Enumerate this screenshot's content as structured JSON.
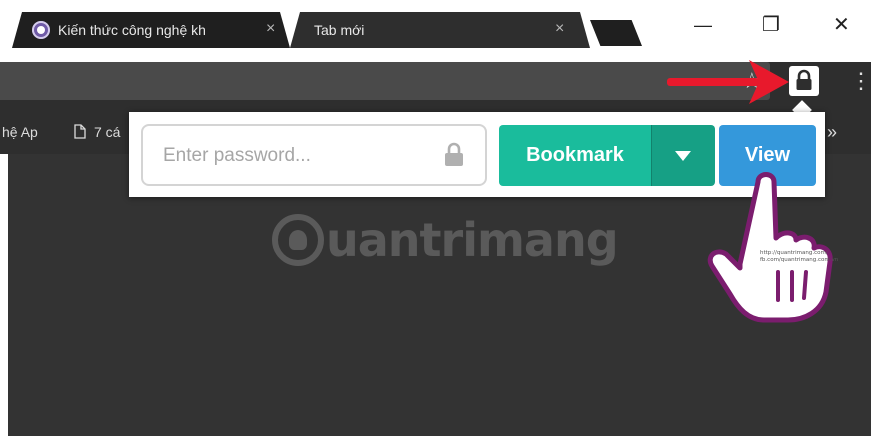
{
  "tabs": [
    {
      "title": "Kiến thức công nghệ kh",
      "active": false
    },
    {
      "title": "Tab mới",
      "active": true
    }
  ],
  "tab_close_glyph": "×",
  "window_controls": {
    "minimize": "—",
    "restore": "❐",
    "close": "✕"
  },
  "toolbar": {
    "star_glyph": "☆",
    "menu_glyph": "⋮"
  },
  "bookmarks": [
    {
      "label": "hệ Ap"
    },
    {
      "label": "7 cá"
    }
  ],
  "bookmarks_overflow": "»",
  "popup": {
    "password_placeholder": "Enter password...",
    "bookmark_label": "Bookmark",
    "view_label": "View"
  },
  "watermark": {
    "text": "uantrimang"
  },
  "hand_caption": [
    "http://quantrimang.com/",
    "fb.com/quantrimang.com.vn"
  ],
  "colors": {
    "bookmark_button": "#1abc9c",
    "view_button": "#3498db",
    "annotation_arrow": "#e8192c"
  },
  "icons": [
    "favicon-icon",
    "close-icon",
    "star-icon",
    "lock-icon",
    "kebab-menu-icon",
    "page-icon",
    "chevron-down-icon",
    "arrow-annotation-icon",
    "hand-pointer-icon"
  ]
}
